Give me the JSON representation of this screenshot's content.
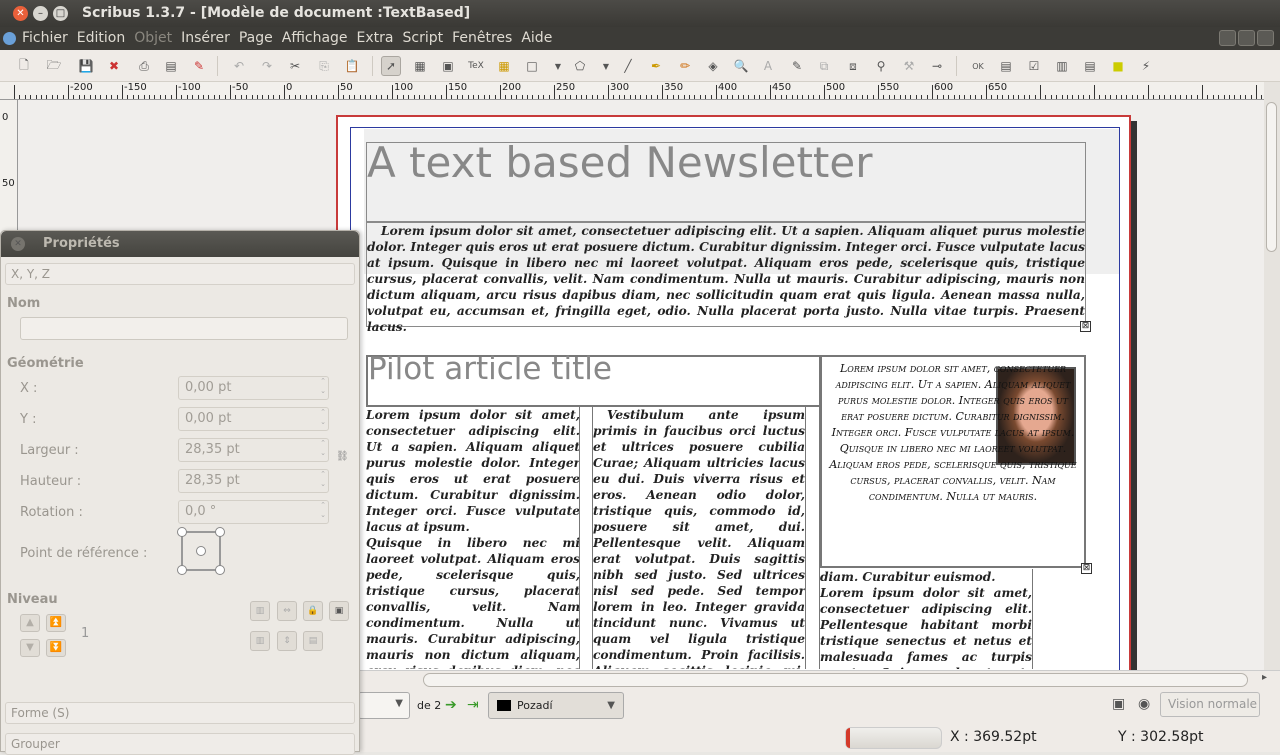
{
  "window": {
    "title": "Scribus 1.3.7 - [Modèle de document :TextBased]"
  },
  "menubar": {
    "items": [
      {
        "label": "Fichier",
        "disabled": false
      },
      {
        "label": "Edition",
        "disabled": false
      },
      {
        "label": "Objet",
        "disabled": true
      },
      {
        "label": "Insérer",
        "disabled": false
      },
      {
        "label": "Page",
        "disabled": false
      },
      {
        "label": "Affichage",
        "disabled": false
      },
      {
        "label": "Extra",
        "disabled": false
      },
      {
        "label": "Script",
        "disabled": false
      },
      {
        "label": "Fenêtres",
        "disabled": false
      },
      {
        "label": "Aide",
        "disabled": false
      }
    ]
  },
  "ruler": {
    "labels": [
      "-200",
      "-150",
      "-100",
      "-50",
      "0",
      "50",
      "100",
      "150",
      "200",
      "250",
      "300",
      "350",
      "400",
      "450",
      "500",
      "550",
      "600",
      "650"
    ],
    "vlabels": [
      "0",
      "50"
    ]
  },
  "document": {
    "newsletter_title": "A text based Newsletter",
    "intro_text": "Lorem ipsum dolor sit amet, consectetuer adipiscing elit. Ut a sapien. Aliquam aliquet purus molestie dolor. Integer quis eros ut erat posuere dictum. Curabitur dignissim. Integer orci. Fusce vulputate lacus at ipsum. Quisque in libero nec mi laoreet volutpat. Aliquam eros pede, scelerisque quis, tristique cursus, placerat convallis, velit. Nam condimentum. Nulla ut mauris. Curabitur adipiscing, mauris non dictum aliquam, arcu risus dapibus diam, nec sollicitudin quam erat quis ligula. Aenean massa nulla, volutpat eu, accumsan et, fringilla eget, odio. Nulla placerat porta justo. Nulla vitae turpis. Praesent lacus.",
    "article_title": "Pilot article title",
    "col1": "Lorem ipsum dolor sit amet, consectetuer adipiscing elit. Ut a sapien. Aliquam aliquet purus molestie dolor. Integer quis eros ut erat posuere dictum. Curabitur dignissim. Integer orci. Fusce vulputate lacus at ipsum.\n  Quisque in libero nec mi laoreet volutpat. Aliquam eros pede, scelerisque quis, tristique cursus, placerat convallis, velit. Nam condimentum. Nulla ut mauris. Curabitur adipiscing, mauris non dictum aliquam, arcu risus dapibus diam, nec sollicitudin quam erat quis ligula. Aenean massa nulla, volutpat eu,",
    "col2": "Vestibulum ante ipsum primis in faucibus orci luctus et ultrices posuere cubilia Curae; Aliquam ultricies lacus eu dui. Duis viverra risus et eros. Aenean odio dolor, tristique quis, commodo id, posuere sit amet, dui. Pellentesque velit. Aliquam erat volutpat. Duis sagittis nibh sed justo. Sed ultrices nisl sed pede. Sed tempor lorem in leo. Integer gravida tincidunt nunc. Vivamus ut quam vel ligula tristique condimentum. Proin facilisis. Aliquam sagittis lacinia mi. Donec sagittis luctus dui. Maecenas quam ante, vestibulum auctor blandit in, iaculis in velit.",
    "col3": "diam. Curabitur euismod.\n  Lorem ipsum dolor sit amet, consectetuer adipiscing elit. Pellentesque habitant morbi tristique senectus et netus et malesuada fames ac turpis egestas. Quisque vel erat eget",
    "sidebar_text": "Lorem ipsum dolor sit amet, consectetuer adipiscing elit. Ut a sapien. Aliquam aliquet purus molestie dolor. Integer quis eros ut erat posuere dictum. Curabitur dignissim. Integer orci. Fusce vulputate lacus at ipsum. Quisque in libero nec mi laoreet volutpat. Aliquam eros pede, scelerisque quis, tristique cursus, placerat convallis, velit. Nam condimentum. Nulla ut mauris."
  },
  "properties": {
    "title": "Propriétés",
    "xyz_section": "X, Y, Z",
    "name_label": "Nom",
    "geometry_label": "Géométrie",
    "x_label": "X :",
    "x_value": "0,00 pt",
    "y_label": "Y :",
    "y_value": "0,00 pt",
    "width_label": "Largeur :",
    "width_value": "28,35 pt",
    "height_label": "Hauteur :",
    "height_value": "28,35 pt",
    "rotation_label": "Rotation :",
    "rotation_value": "0,0 °",
    "ref_point_label": "Point de référence :",
    "level_label": "Niveau",
    "level_value": "1",
    "shape_section": "Forme (S)",
    "group_section": "Grouper"
  },
  "statusbar": {
    "page_of": "de 2",
    "layer": "Pozadí",
    "vision": "Vision normale",
    "coord_x": "X : 369.52pt",
    "coord_y": "Y : 302.58pt",
    "progress": 0.04
  },
  "colors": {
    "accent_red": "#c83a3a",
    "margin_blue": "#2c3aa0"
  }
}
